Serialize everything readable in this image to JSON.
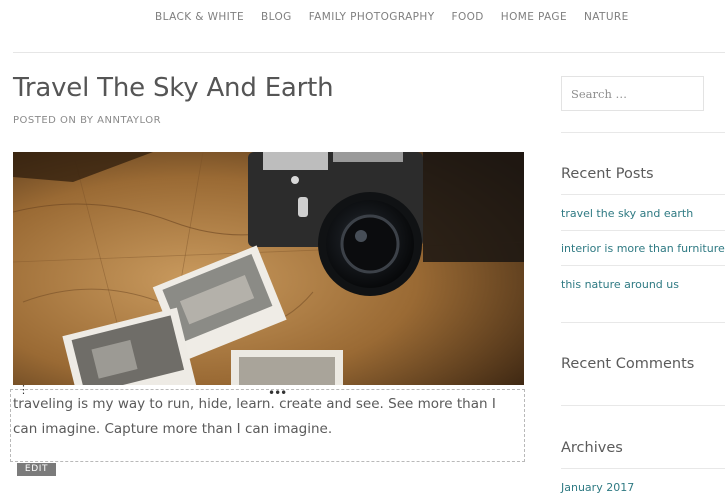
{
  "nav": {
    "items": [
      "BLACK & WHITE",
      "BLOG",
      "FAMILY PHOTOGRAPHY",
      "FOOD",
      "HOME PAGE",
      "NATURE"
    ]
  },
  "post": {
    "title": "Travel The Sky And Earth",
    "meta": "POSTED ON BY ANNTAYLOR",
    "text": "traveling is my way to run, hide, learn. create and see. See more than I can imagine. Capture more than I can imagine.",
    "edit_label": "EDIT"
  },
  "sidebar": {
    "search_placeholder": "Search …",
    "recent_posts_title": "Recent Posts",
    "recent_posts": [
      "travel the sky and earth",
      "interior is more than furniture",
      "this nature around us"
    ],
    "recent_comments_title": "Recent Comments",
    "archives_title": "Archives",
    "archives": [
      "January 2017"
    ]
  },
  "colors": {
    "link": "#2f7a83",
    "edit_button": "#7b7b7b"
  }
}
